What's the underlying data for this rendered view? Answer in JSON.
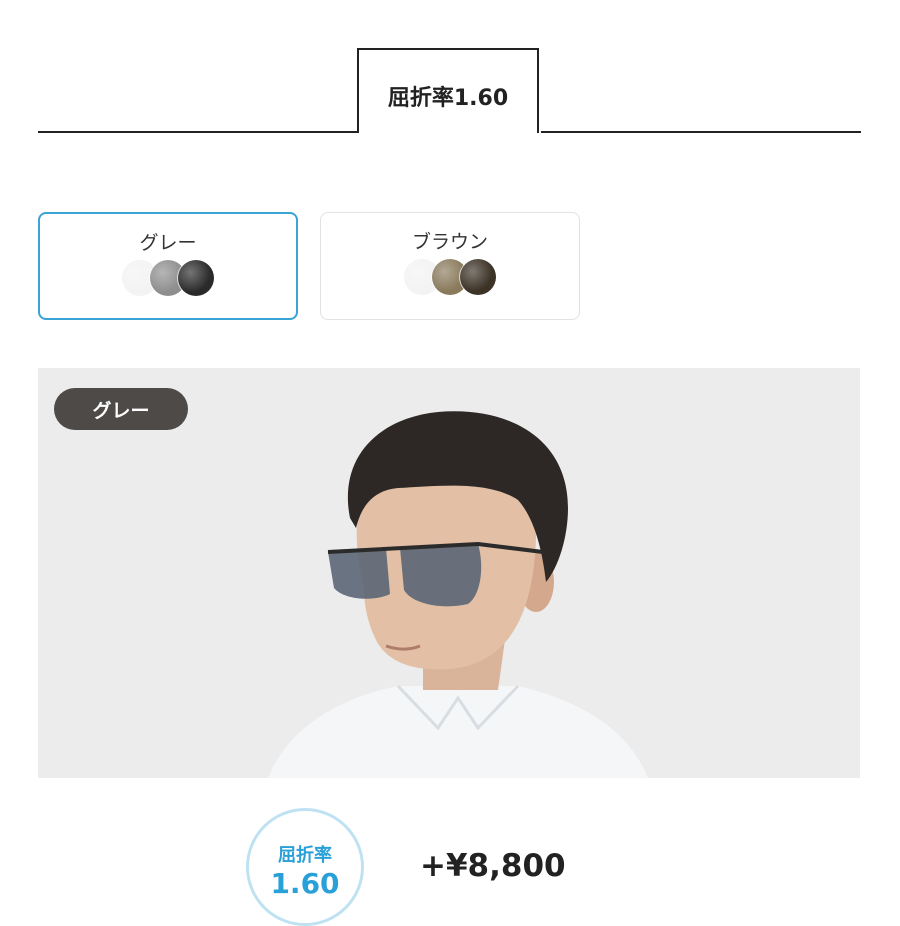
{
  "tabs": {
    "active_label": "屈折率1.60"
  },
  "color_options": [
    {
      "label": "グレー",
      "selected": true,
      "swatches": [
        "#f3f3f3",
        "#8e8e8e",
        "#2a2a2a"
      ]
    },
    {
      "label": "ブラウン",
      "selected": false,
      "swatches": [
        "#f3f3f3",
        "#8a7a5c",
        "#3c3226"
      ]
    }
  ],
  "hero": {
    "badge_label": "グレー"
  },
  "summary": {
    "index_label": "屈折率",
    "index_value": "1.60",
    "price": "+¥8,800"
  },
  "colors": {
    "accent": "#2aa0d8",
    "selected_border": "#3aa4d6",
    "badge_bg": "#4e4a48",
    "hero_bg": "#ececec"
  }
}
